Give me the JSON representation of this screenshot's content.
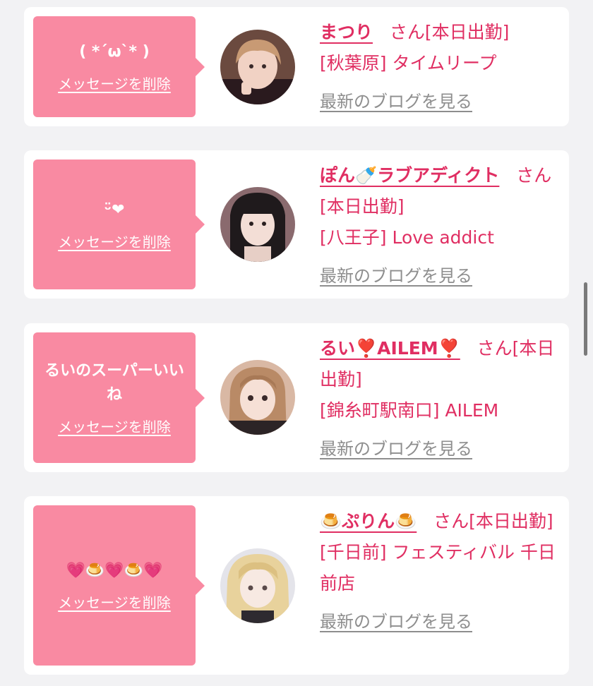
{
  "delete_label": "メッセージを削除",
  "blog_label": "最新のブログを見る",
  "san_suffix": "さん",
  "cards": [
    {
      "bubble_message": "( *´ω`* )",
      "name": "まつり",
      "status": "[本日出勤]",
      "shop": "[秋葉原] タイムリープ"
    },
    {
      "bubble_message": "ᵕ̈❤",
      "name": "ぽん🍼ラブアディクト",
      "status": "[本日出勤]",
      "shop": "[八王子] Love addict"
    },
    {
      "bubble_message": "るいのスーパーいいね",
      "name": "るい❣️AILEM❣️",
      "status": "[本日出勤]",
      "shop": "[錦糸町駅南口] AILEM"
    },
    {
      "bubble_message": "💗🍮💗🍮💗",
      "name": "🍮ぷりん🍮",
      "status": "[本日出勤]",
      "shop": "[千日前] フェスティバル 千日前店"
    }
  ],
  "colors": {
    "bubble": "#f98aa2",
    "accent": "#e02e62",
    "link_gray": "#8e8e8e",
    "background": "#f2f2f4"
  }
}
